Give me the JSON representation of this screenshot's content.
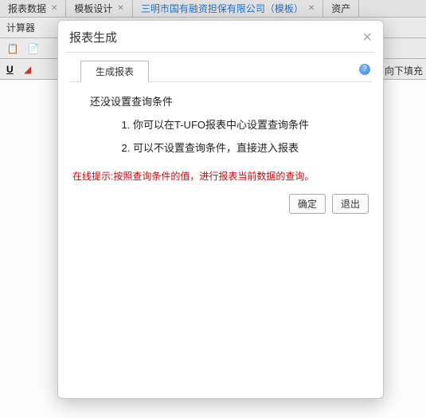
{
  "tabs": [
    {
      "label": "报表数据"
    },
    {
      "label": "模板设计"
    },
    {
      "label": "三明市国有融资担保有限公司（模板）",
      "active": true
    },
    {
      "label": "资产"
    }
  ],
  "toolbar": {
    "calculator": "计算器"
  },
  "rightHint": "向下填充",
  "modal": {
    "title": "报表生成",
    "tabLabel": "生成报表",
    "heading": "还没设置查询条件",
    "items": [
      "你可以在T-UFO报表中心设置查询条件",
      "可以不设置查询条件，直接进入报表"
    ],
    "hint": "在线提示:按照查询条件的值，进行报表当前数据的查询。",
    "okLabel": "确定",
    "cancelLabel": "退出"
  }
}
